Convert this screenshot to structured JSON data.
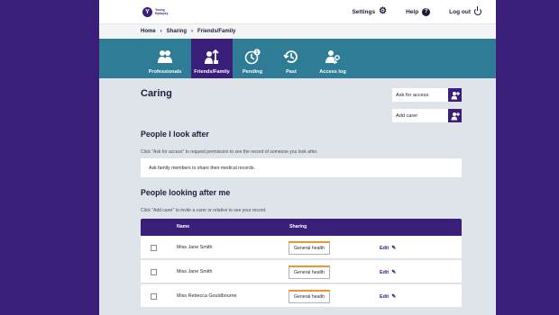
{
  "logo": {
    "mark": "Y",
    "text": "Young Epilepsy"
  },
  "topnav": {
    "settings": "Settings",
    "help": "Help",
    "logout": "Log out"
  },
  "breadcrumb": [
    "Home",
    "Sharing",
    "Friends/Family"
  ],
  "tabs": [
    {
      "label": "Professionals",
      "icon": "professionals-icon",
      "active": false
    },
    {
      "label": "Friends/Family",
      "icon": "friends-family-icon",
      "active": true
    },
    {
      "label": "Pending",
      "icon": "pending-icon",
      "active": false,
      "badge": "1"
    },
    {
      "label": "Past",
      "icon": "past-icon",
      "active": false
    },
    {
      "label": "Access log",
      "icon": "access-log-icon",
      "active": false
    }
  ],
  "page": {
    "title": "Caring",
    "ask_for_access": "Ask for access",
    "add_carer": "Add carer",
    "section1_title": "People I look after",
    "section1_help": "Click \"Ask for access\" to request permission to see the record of someone you look after.",
    "section1_box": "Ask family members to share their medical records.",
    "section2_title": "People looking after me",
    "section2_help": "Click \"Add carer\" to invite a carer or relative to see your record."
  },
  "table": {
    "headers": {
      "name": "Name",
      "sharing": "Sharing"
    },
    "rows": [
      {
        "name": "Miss Jane Smith",
        "sharing": "General health",
        "edit": "Edit"
      },
      {
        "name": "Miss Jane Smith",
        "sharing": "General health",
        "edit": "Edit"
      },
      {
        "name": "Miss Rebecca Gouldbourne",
        "sharing": "General health",
        "edit": "Edit"
      }
    ]
  },
  "colors": {
    "background": "#3a1f7a",
    "brand_purple": "#3a1f7a",
    "tab_bar": "#2f7c96",
    "accent_orange": "#e8972e"
  }
}
